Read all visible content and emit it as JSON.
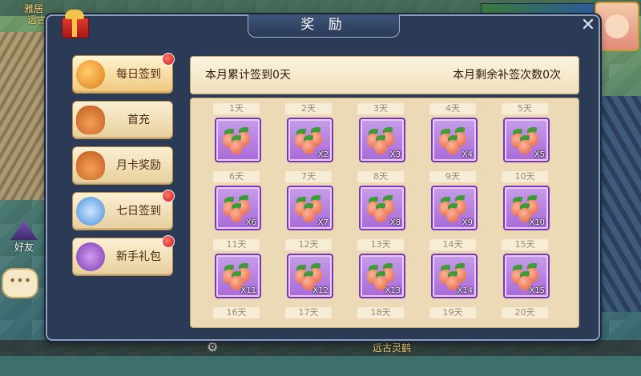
{
  "hud": {
    "top_left_1": "雅居",
    "top_left_2": "远古",
    "friend_label": "好友",
    "chat_icon": "chat-bubble-icon",
    "bottom_name": "远古灵鹤"
  },
  "dialog": {
    "title": "奖 励",
    "close_label": "✕"
  },
  "menu": {
    "items": [
      {
        "label": "每日签到",
        "icon": "coin-icon",
        "badge": true
      },
      {
        "label": "首充",
        "icon": "money-bag-icon",
        "badge": false
      },
      {
        "label": "月卡奖励",
        "icon": "money-bag-icon",
        "badge": false
      },
      {
        "label": "七日签到",
        "icon": "silver-ingot-icon",
        "badge": true
      },
      {
        "label": "新手礼包",
        "icon": "gift-pack-icon",
        "badge": true
      }
    ]
  },
  "info": {
    "signed_text": "本月累计签到0天",
    "remaining_text": "本月剩余补签次数0次"
  },
  "rewards": {
    "days": [
      "1天",
      "2天",
      "3天",
      "4天",
      "5天",
      "6天",
      "7天",
      "8天",
      "9天",
      "10天",
      "11天",
      "12天",
      "13天",
      "14天",
      "15天",
      "16天",
      "17天",
      "18天",
      "19天",
      "20天"
    ],
    "items": [
      {
        "qty": ""
      },
      {
        "qty": "X2"
      },
      {
        "qty": "X3"
      },
      {
        "qty": "X4"
      },
      {
        "qty": "X5"
      },
      {
        "qty": "X6"
      },
      {
        "qty": "X7"
      },
      {
        "qty": "X8"
      },
      {
        "qty": "X9"
      },
      {
        "qty": "X10"
      },
      {
        "qty": "X11"
      },
      {
        "qty": "X12"
      },
      {
        "qty": "X13"
      },
      {
        "qty": "X14"
      },
      {
        "qty": "X15"
      }
    ],
    "item_icon": "ginseng-fruit-icon"
  },
  "colors": {
    "slot_border": "#7a36b6",
    "badge": "#d4121a",
    "panel": "#ecd9b5"
  }
}
